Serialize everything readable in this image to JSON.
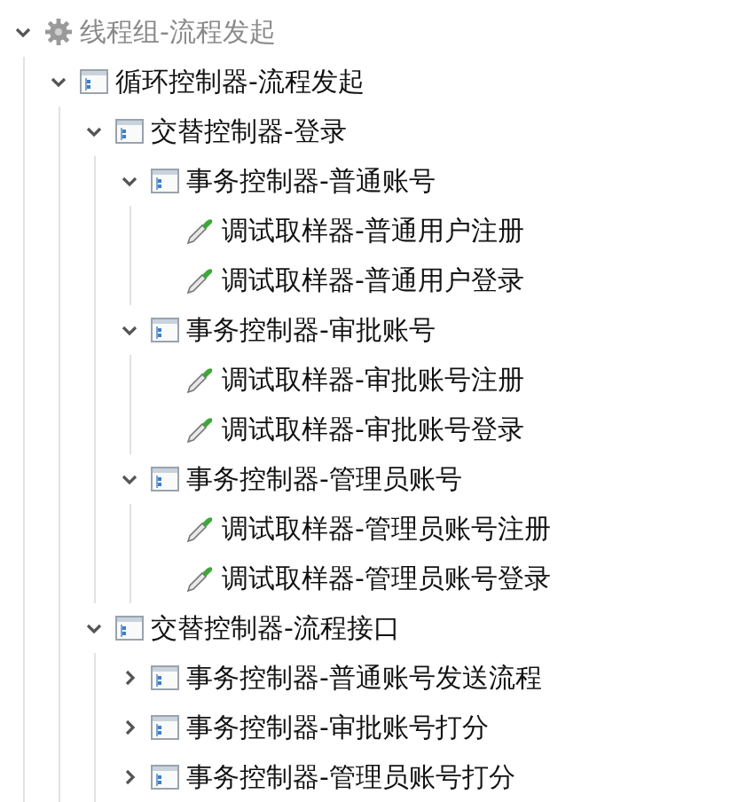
{
  "tree": [
    {
      "kind": "thread_group",
      "label": "线程组-流程发起",
      "disabled": true,
      "expanded": true,
      "children": [
        {
          "kind": "controller",
          "label": "循环控制器-流程发起",
          "disabled": false,
          "expanded": true,
          "children": [
            {
              "kind": "controller",
              "label": "交替控制器-登录",
              "disabled": false,
              "expanded": true,
              "children": [
                {
                  "kind": "controller",
                  "label": "事务控制器-普通账号",
                  "disabled": false,
                  "expanded": true,
                  "children": [
                    {
                      "kind": "sampler",
                      "label": "调试取样器-普通用户注册",
                      "disabled": false
                    },
                    {
                      "kind": "sampler",
                      "label": "调试取样器-普通用户登录",
                      "disabled": false
                    }
                  ]
                },
                {
                  "kind": "controller",
                  "label": "事务控制器-审批账号",
                  "disabled": false,
                  "expanded": true,
                  "children": [
                    {
                      "kind": "sampler",
                      "label": "调试取样器-审批账号注册",
                      "disabled": false
                    },
                    {
                      "kind": "sampler",
                      "label": "调试取样器-审批账号登录",
                      "disabled": false
                    }
                  ]
                },
                {
                  "kind": "controller",
                  "label": "事务控制器-管理员账号",
                  "disabled": false,
                  "expanded": true,
                  "children": [
                    {
                      "kind": "sampler",
                      "label": "调试取样器-管理员账号注册",
                      "disabled": false
                    },
                    {
                      "kind": "sampler",
                      "label": "调试取样器-管理员账号登录",
                      "disabled": false
                    }
                  ]
                }
              ]
            },
            {
              "kind": "controller",
              "label": "交替控制器-流程接口",
              "disabled": false,
              "expanded": true,
              "children": [
                {
                  "kind": "controller",
                  "label": "事务控制器-普通账号发送流程",
                  "disabled": false,
                  "expanded": false
                },
                {
                  "kind": "controller",
                  "label": "事务控制器-审批账号打分",
                  "disabled": false,
                  "expanded": false
                },
                {
                  "kind": "controller",
                  "label": "事务控制器-管理员账号打分",
                  "disabled": false,
                  "expanded": false
                }
              ]
            }
          ]
        }
      ]
    }
  ]
}
